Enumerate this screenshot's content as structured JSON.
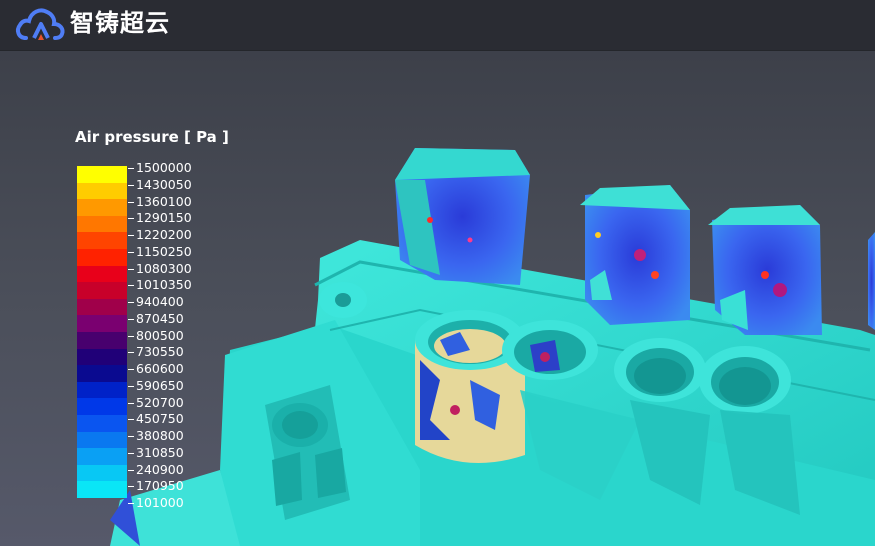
{
  "app": {
    "brand": "智铸超云",
    "logo_icon": "cloud-logo-icon"
  },
  "legend": {
    "title": "Air pressure [ Pa ]",
    "ticks": [
      "1500000",
      "1430050",
      "1360100",
      "1290150",
      "1220200",
      "1150250",
      "1080300",
      "1010350",
      "940400",
      "870450",
      "800500",
      "730550",
      "660600",
      "590650",
      "520700",
      "450750",
      "380800",
      "310850",
      "240900",
      "170950",
      "101000"
    ],
    "colors": [
      "#ffff00",
      "#ffcc00",
      "#ff9900",
      "#ff7700",
      "#ff4400",
      "#ff2200",
      "#e8001a",
      "#c8002a",
      "#a0004a",
      "#7a0070",
      "#48006e",
      "#200078",
      "#0a0a90",
      "#0022c8",
      "#0038e8",
      "#0a55f0",
      "#0a78f0",
      "#0aa0f4",
      "#08c8f4",
      "#0ae6f6"
    ]
  },
  "scene": {
    "description_icon": "casting-3d-model-icon",
    "accent_color": "#33e0d4"
  }
}
